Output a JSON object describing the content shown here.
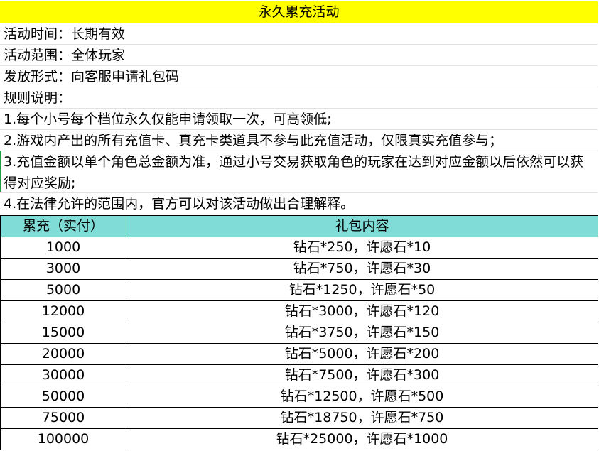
{
  "title": "永久累充活动",
  "info_lines": [
    "活动时间：长期有效",
    "活动范围：全体玩家",
    "发放形式：向客服申请礼包码",
    "规则说明：",
    "1.每个小号每个档位永久仅能申请领取一次，可高领低;",
    "2.游戏内产出的所有充值卡、真充卡类道具不参与此充值活动，仅限真实充值参与；",
    "3.充值金额以单个角色总金额为准，通过小号交易获取角色的玩家在达到对应金额以后依然可以获得对应奖励;",
    "4.在法律允许的范围内，官方可以对该活动做出合理解释。"
  ],
  "table": {
    "headers": [
      "累充（实付）",
      "礼包内容"
    ],
    "rows": [
      [
        "1000",
        "钻石*250，许愿石*10"
      ],
      [
        "3000",
        "钻石*750，许愿石*30"
      ],
      [
        "5000",
        "钻石*1250，许愿石*50"
      ],
      [
        "12000",
        "钻石*3000，许愿石*120"
      ],
      [
        "15000",
        "钻石*3750，许愿石*150"
      ],
      [
        "20000",
        "钻石*5000，许愿石*200"
      ],
      [
        "30000",
        "钻石*7500，许愿石*300"
      ],
      [
        "50000",
        "钻石*12500，许愿石*500"
      ],
      [
        "75000",
        "钻石*18750，许愿石*750"
      ],
      [
        "100000",
        "钻石*25000，许愿石*1000"
      ]
    ]
  }
}
